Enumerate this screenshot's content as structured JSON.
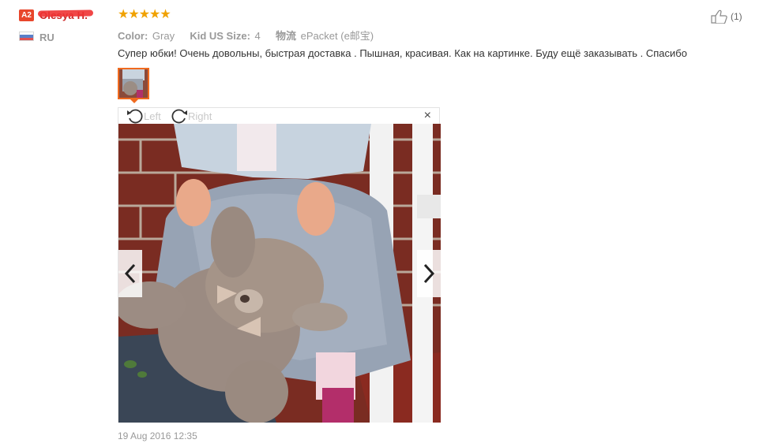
{
  "user": {
    "level_badge": "A2",
    "name": "Olesya H.",
    "country": "RU",
    "flag_icon": "russia-flag-icon"
  },
  "review": {
    "rating": 5,
    "stars": "★★★★★",
    "attributes": [
      {
        "label": "Color:",
        "value": "Gray"
      },
      {
        "label": "Kid US Size:",
        "value": "4"
      },
      {
        "label": "物流",
        "value": "ePacket (e邮宝)"
      }
    ],
    "text": "Супер юбки! Очень довольны, быстрая доставка . Пышная, красивая. Как на картинке. Буду ещё заказывать . Спасибо",
    "helpful_count": "(1)",
    "timestamp": "19 Aug 2016 12:35"
  },
  "viewer": {
    "rotate_left_label": "Left",
    "rotate_right_label": "Right",
    "close_label": "×"
  },
  "colors": {
    "accent": "#f06a1f",
    "star": "#f0a200",
    "badge": "#e8462b"
  }
}
